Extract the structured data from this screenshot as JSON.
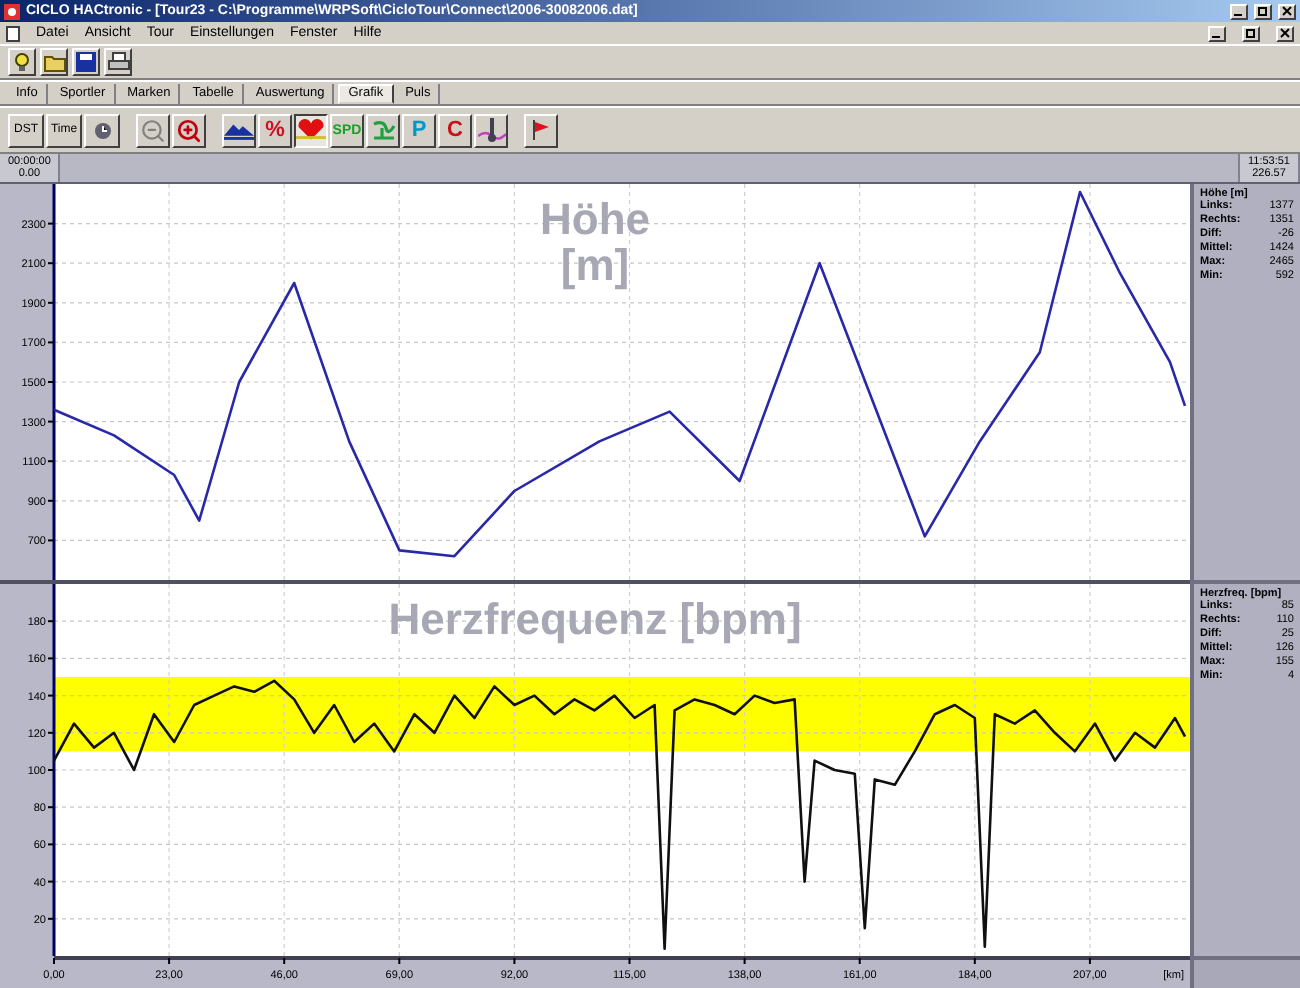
{
  "window": {
    "title": "CICLO HACtronic - [Tour23 - C:\\Programme\\WRPSoft\\CicloTour\\Connect\\2006-30082006.dat]"
  },
  "menu": [
    "Datei",
    "Ansicht",
    "Tour",
    "Einstellungen",
    "Fenster",
    "Hilfe"
  ],
  "tabs": [
    {
      "label": "Info",
      "selected": false
    },
    {
      "label": "Sportler",
      "selected": false
    },
    {
      "label": "Marken",
      "selected": false
    },
    {
      "label": "Tabelle",
      "selected": false
    },
    {
      "label": "Auswertung",
      "selected": false
    },
    {
      "label": "Grafik",
      "selected": true
    },
    {
      "label": "Puls",
      "selected": false
    }
  ],
  "graph_toolbar": {
    "mode_buttons": [
      {
        "label": "DST"
      },
      {
        "label": "Time"
      }
    ],
    "channel_buttons": [
      {
        "kind": "icon",
        "selected": false
      },
      {
        "kind": "text",
        "label": "%",
        "color": "#d01020",
        "selected": false
      },
      {
        "kind": "icon",
        "selected": true
      },
      {
        "kind": "text",
        "label": "SPD",
        "color": "#18a028",
        "selected": false
      },
      {
        "kind": "icon",
        "selected": false
      },
      {
        "kind": "text",
        "label": "P",
        "color": "#0098c8",
        "selected": false
      },
      {
        "kind": "text",
        "label": "C",
        "color": "#c81018",
        "selected": false
      },
      {
        "kind": "icon",
        "selected": false
      }
    ]
  },
  "cursor": {
    "start_time": "00:00:00",
    "start_distance": "0.00",
    "end_time": "11:53:51",
    "end_distance": "226.57"
  },
  "charts": [
    {
      "stats": {
        "title": "Höhe [m]",
        "rows": [
          {
            "label": "Links:",
            "value": "1377"
          },
          {
            "label": "Rechts:",
            "value": "1351"
          },
          {
            "label": "Diff:",
            "value": "-26"
          },
          {
            "label": "Mittel:",
            "value": "1424"
          },
          {
            "label": "Max:",
            "value": "2465"
          },
          {
            "label": "Min:",
            "value": "592"
          }
        ]
      },
      "chart_data": {
        "type": "line",
        "title": "Höhe [m]",
        "xlim": [
          0,
          227
        ],
        "ylim": [
          500,
          2500
        ],
        "yticks": [
          700,
          900,
          1100,
          1300,
          1500,
          1700,
          1900,
          2100,
          2300
        ],
        "grid": true,
        "x": [
          0,
          12,
          24,
          29,
          37,
          48,
          59,
          69,
          80,
          92,
          109,
          123,
          137,
          153,
          174,
          185,
          197,
          205,
          213,
          223,
          226
        ],
        "series": [
          {
            "color": "#2828a8",
            "values": [
              1360,
              1230,
              1030,
              800,
              1500,
              2000,
              1200,
              650,
              620,
              950,
              1200,
              1350,
              1000,
              2100,
              720,
              1200,
              1650,
              2460,
              2050,
              1600,
              1380
            ]
          }
        ]
      }
    },
    {
      "stats": {
        "title": "Herzfreq. [bpm]",
        "rows": [
          {
            "label": "Links:",
            "value": "85"
          },
          {
            "label": "Rechts:",
            "value": "110"
          },
          {
            "label": "Diff:",
            "value": "25"
          },
          {
            "label": "Mittel:",
            "value": "126"
          },
          {
            "label": "Max:",
            "value": "155"
          },
          {
            "label": "Min:",
            "value": "4"
          }
        ]
      },
      "chart_data": {
        "type": "line",
        "title": "Herzfrequenz [bpm]",
        "xlabel": "[km]",
        "xlim": [
          0,
          227
        ],
        "ylim": [
          0,
          200
        ],
        "yticks": [
          20,
          40,
          60,
          80,
          100,
          120,
          140,
          160,
          180
        ],
        "xticks": [
          {
            "value": 0,
            "label": "0,00"
          },
          {
            "value": 23,
            "label": "23,00"
          },
          {
            "value": 46,
            "label": "46,00"
          },
          {
            "value": 69,
            "label": "69,00"
          },
          {
            "value": 92,
            "label": "92,00"
          },
          {
            "value": 115,
            "label": "115,00"
          },
          {
            "value": 138,
            "label": "138,00"
          },
          {
            "value": 161,
            "label": "161,00"
          },
          {
            "value": 184,
            "label": "184,00"
          },
          {
            "value": 207,
            "label": "207,00"
          }
        ],
        "grid": true,
        "bands": [
          {
            "axis": "y",
            "from": 110,
            "to": 150,
            "color": "#ffff00"
          }
        ],
        "x": [
          0,
          4,
          8,
          12,
          16,
          20,
          24,
          28,
          32,
          36,
          40,
          44,
          48,
          52,
          56,
          60,
          64,
          68,
          72,
          76,
          80,
          84,
          88,
          92,
          96,
          100,
          104,
          108,
          112,
          116,
          120,
          122,
          124,
          128,
          132,
          136,
          140,
          144,
          148,
          150,
          152,
          156,
          160,
          162,
          164,
          168,
          172,
          176,
          180,
          184,
          186,
          188,
          192,
          196,
          200,
          204,
          208,
          212,
          216,
          220,
          224,
          226
        ],
        "series": [
          {
            "color": "#101010",
            "values": [
              105,
              125,
              112,
              120,
              100,
              130,
              115,
              135,
              140,
              145,
              142,
              148,
              138,
              120,
              135,
              115,
              125,
              110,
              130,
              120,
              140,
              128,
              145,
              135,
              140,
              130,
              138,
              132,
              140,
              128,
              135,
              4,
              132,
              138,
              135,
              130,
              140,
              136,
              138,
              40,
              105,
              100,
              98,
              15,
              95,
              92,
              110,
              130,
              135,
              128,
              5,
              130,
              125,
              132,
              120,
              110,
              125,
              105,
              120,
              112,
              128,
              118
            ]
          }
        ]
      }
    }
  ]
}
